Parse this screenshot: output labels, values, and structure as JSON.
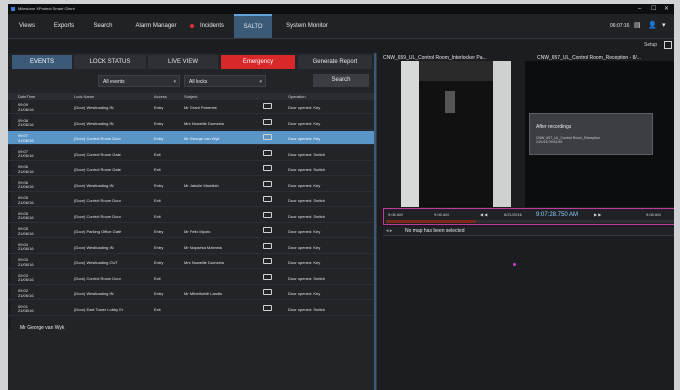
{
  "window": {
    "title": "Milestone XProtect Smart Client",
    "controls": {
      "minimize": "–",
      "maximize": "☐",
      "close": "✕"
    }
  },
  "menu": {
    "items": [
      "Views",
      "Exports",
      "Search",
      "Alarm Manager",
      "Incidents",
      "SALTO",
      "System Monitor"
    ],
    "active": "SALTO",
    "time": "06:07:16",
    "setup": "Setup"
  },
  "events_panel": {
    "tabs": [
      "EVENTS",
      "LOCK STATUS",
      "LIVE VIEW"
    ],
    "active_tab": "EVENTS",
    "emergency_label": "Emergency",
    "report_label": "Generate Report",
    "filter_events": "All events",
    "filter_locks": "All locks",
    "search_label": "Search",
    "columns": [
      "DateTime",
      "Lock Name",
      "Access",
      "Subject",
      "",
      "Operation"
    ],
    "rows": [
      {
        "date": "09:09",
        "date2": "21/06/16",
        "lock": "(Door) Westloading IN",
        "access": "Entry",
        "subject": "Mr Grant Panenee",
        "op": "Door opened: Key"
      },
      {
        "date": "09:08",
        "date2": "21/06/16",
        "lock": "(Door) Westloading IN",
        "access": "Entry",
        "subject": "Mrs Nowellie Dumzela",
        "op": "Door opened: Key"
      },
      {
        "date": "09:07",
        "date2": "21/06/16",
        "lock": "(Door) Control Room Door",
        "access": "Entry",
        "subject": "Mr George van Wyk",
        "op": "Door opened: Key"
      },
      {
        "date": "09:07",
        "date2": "21/06/16",
        "lock": "(Door) Control Room Gate",
        "access": "Exit",
        "subject": "",
        "op": "Door opened: Switch"
      },
      {
        "date": "09:06",
        "date2": "21/06/16",
        "lock": "(Door) Control Room Gate",
        "access": "Exit",
        "subject": "",
        "op": "Door opened: Switch"
      },
      {
        "date": "09:06",
        "date2": "21/06/16",
        "lock": "(Door) Westloading IN",
        "access": "Entry",
        "subject": "Mr Jakulie Mandlah",
        "op": "Door opened: Key"
      },
      {
        "date": "09:05",
        "date2": "21/06/16",
        "lock": "(Door) Control Room Door",
        "access": "Exit",
        "subject": "",
        "op": "Door opened: Switch"
      },
      {
        "date": "09:05",
        "date2": "21/06/16",
        "lock": "(Door) Control Room Door",
        "access": "Exit",
        "subject": "",
        "op": "Door opened: Switch"
      },
      {
        "date": "09:05",
        "date2": "21/06/16",
        "lock": "(Door) Parking Office Gate",
        "access": "Entry",
        "subject": "Mr Felix Mpofu",
        "op": "Door opened: Key"
      },
      {
        "date": "09:04",
        "date2": "21/06/16",
        "lock": "(Door) Westloading IN",
        "access": "Entry",
        "subject": "Mr Nopaeka Mzimela",
        "op": "Door opened: Key"
      },
      {
        "date": "09:03",
        "date2": "21/06/16",
        "lock": "(Door) Westloading OUT",
        "access": "Entry",
        "subject": "Mrs Nowellie Dumzela",
        "op": "Door opened: Key"
      },
      {
        "date": "09:03",
        "date2": "21/06/16",
        "lock": "(Door) Control Room Door",
        "access": "Exit",
        "subject": "",
        "op": "Door opened: Switch"
      },
      {
        "date": "09:02",
        "date2": "21/06/16",
        "lock": "(Door) Westloading IN",
        "access": "Entry",
        "subject": "Mr Mthethobili Landis",
        "op": "Door opened: Key"
      },
      {
        "date": "09:01",
        "date2": "21/06/16",
        "lock": "(Door) East Tower Lobby Er",
        "access": "Exit",
        "subject": "",
        "op": "Door opened: Switch"
      }
    ],
    "selected_row": 2,
    "footer_subject": "Mr George van Wyk"
  },
  "video": {
    "camera_left": "CNW_659_UL_Control Room_Interlocker Pa...",
    "camera_right": "CNW_657_UL_Control Room_Reception - 8/...",
    "after_title": "After recordings",
    "after_detail": "CNW_657_UL_Control Room_Reception",
    "after_time": "1/21/16 09:51:59",
    "timeline_left": "9:06 AM",
    "timeline_l2": "9:06 AM",
    "timeline_date": "6/21/2016",
    "timeline_current": "9:07:28.750 AM",
    "timeline_right": "9:08 AM",
    "map_message": "No map has been selected"
  }
}
